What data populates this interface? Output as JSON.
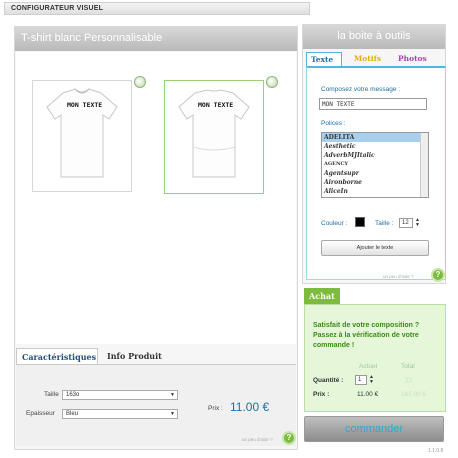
{
  "app": {
    "title": "CONFIGURATEUR VISUEL",
    "version": "1.1.0.8"
  },
  "left": {
    "title": "T-shirt blanc Personnalisable",
    "front_text": "MON TEXTE",
    "back_text": "MON TEXTE",
    "tabs": [
      {
        "label": "Caractéristiques"
      },
      {
        "label": "Info Produit"
      }
    ],
    "size_label": "Taille",
    "size_value": "163o",
    "thickness_label": "Epaisseur",
    "thickness_value": "Bleu",
    "price_label": "Prix :",
    "price_value": "11.00 €",
    "help_hint": "un peu d'aide ?"
  },
  "toolbox": {
    "title": "la boite à outils",
    "tabs": [
      {
        "label": "Texte",
        "color": "#1e6fa8"
      },
      {
        "label": "Motifs",
        "color": "#e0b000"
      },
      {
        "label": "Photos",
        "color": "#b040b0"
      }
    ],
    "message_label": "Composez votre message :",
    "message_value": "MON TEXTE",
    "fonts_label": "Polices :",
    "fonts": [
      "ADELITA",
      "Aesthetic",
      "AdverbMJItalic",
      "AGENCY",
      "Agentsupr",
      "Aironborne",
      "AliceIn"
    ],
    "color_label": "Couleur :",
    "size_label": "Taille :",
    "size_value": "12",
    "add_button": "Ajouter le texte",
    "help_hint": "un peu d'aide ?"
  },
  "achat": {
    "tab": "Achat",
    "message": "Satisfait de votre composition ? Passez à la vérification de votre commande !",
    "col_actual": "Actuel",
    "col_total": "Total",
    "qty_label": "Quantité :",
    "qty_value": "1",
    "qty_total": "12",
    "price_label": "Prix :",
    "price_actual": "11.00 €",
    "price_total": "165.00 €",
    "order_button": "commander"
  }
}
